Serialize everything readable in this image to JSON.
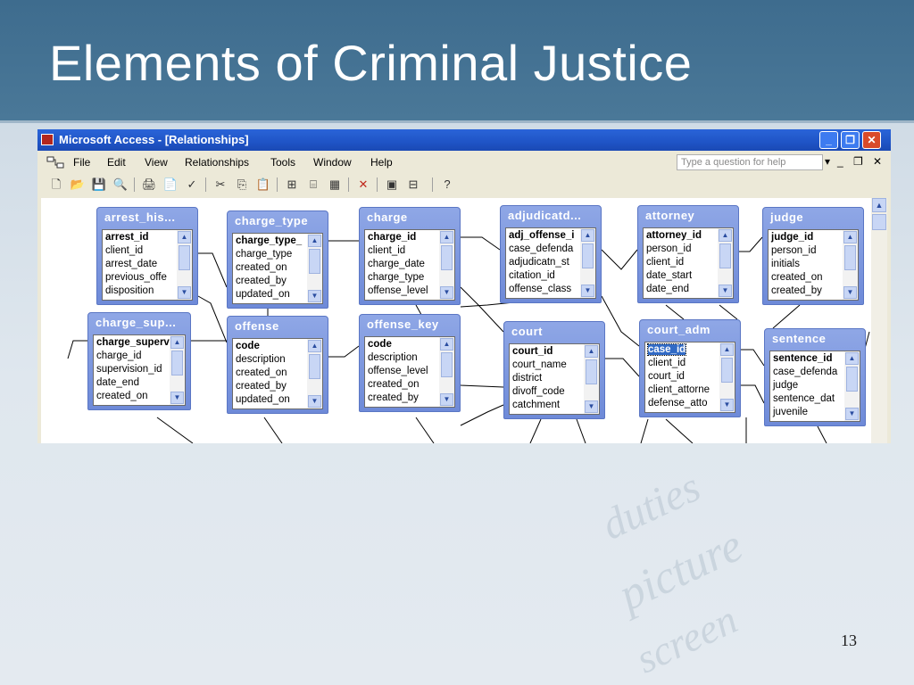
{
  "slide": {
    "title": "Elements of Criminal Justice",
    "page_number": "13",
    "background_words": [
      "duties",
      "picture",
      "screen"
    ]
  },
  "window": {
    "title": "Microsoft Access - [Relationships]",
    "buttons": {
      "minimize": "_",
      "restore": "❐",
      "close": "✕"
    }
  },
  "menu": {
    "items": [
      "File",
      "Edit",
      "View",
      "Relationships",
      "Tools",
      "Window",
      "Help"
    ],
    "ask_placeholder": "Type a question for help",
    "right_controls": [
      "▾",
      "_",
      "❐",
      "✕"
    ]
  },
  "toolbar": {
    "icons": [
      "new-icon",
      "open-icon",
      "save-icon",
      "search-icon",
      "print-icon",
      "print-preview-icon",
      "spelling-icon",
      "cut-icon",
      "copy-icon",
      "paste-icon",
      "show-table-icon",
      "show-direct-icon",
      "show-all-icon",
      "delete-icon",
      "database-window-icon",
      "new-object-icon",
      "help-icon"
    ],
    "glyphs": [
      "🗋",
      "📂",
      "💾",
      "🔍",
      "🖨",
      "📄",
      "✓",
      "✂",
      "⎘",
      "📋",
      "⊞",
      "⌸",
      "▦",
      "✕",
      "▣",
      "⊟",
      "?"
    ]
  },
  "tables": [
    {
      "id": "arrest_history",
      "title": "arrest_his...",
      "fields": [
        {
          "name": "arrest_id",
          "pk": true
        },
        {
          "name": "client_id"
        },
        {
          "name": "arrest_date"
        },
        {
          "name": "previous_offe"
        },
        {
          "name": "disposition"
        }
      ]
    },
    {
      "id": "charge_type",
      "title": "charge_type",
      "fields": [
        {
          "name": "charge_type_",
          "pk": true
        },
        {
          "name": "charge_type"
        },
        {
          "name": "created_on"
        },
        {
          "name": "created_by"
        },
        {
          "name": "updated_on"
        }
      ]
    },
    {
      "id": "charge",
      "title": "charge",
      "fields": [
        {
          "name": "charge_id",
          "pk": true
        },
        {
          "name": "client_id"
        },
        {
          "name": "charge_date"
        },
        {
          "name": "charge_type"
        },
        {
          "name": "offense_level"
        }
      ]
    },
    {
      "id": "adjudicatd",
      "title": "adjudicatd...",
      "fields": [
        {
          "name": "adj_offense_i",
          "pk": true
        },
        {
          "name": "case_defenda"
        },
        {
          "name": "adjudicatn_st"
        },
        {
          "name": "citation_id"
        },
        {
          "name": "offense_class"
        }
      ]
    },
    {
      "id": "attorney",
      "title": "attorney",
      "fields": [
        {
          "name": "attorney_id",
          "pk": true
        },
        {
          "name": "person_id"
        },
        {
          "name": "client_id"
        },
        {
          "name": "date_start"
        },
        {
          "name": "date_end"
        }
      ]
    },
    {
      "id": "judge",
      "title": "judge",
      "fields": [
        {
          "name": "judge_id",
          "pk": true
        },
        {
          "name": "person_id"
        },
        {
          "name": "initials"
        },
        {
          "name": "created_on"
        },
        {
          "name": "created_by"
        }
      ]
    },
    {
      "id": "charge_sup",
      "title": "charge_sup...",
      "fields": [
        {
          "name": "charge_superv",
          "pk": true
        },
        {
          "name": "charge_id"
        },
        {
          "name": "supervision_id"
        },
        {
          "name": "date_end"
        },
        {
          "name": "created_on"
        }
      ]
    },
    {
      "id": "offense",
      "title": "offense",
      "fields": [
        {
          "name": "code",
          "pk": true
        },
        {
          "name": "description"
        },
        {
          "name": "created_on"
        },
        {
          "name": "created_by"
        },
        {
          "name": "updated_on"
        }
      ]
    },
    {
      "id": "offense_key",
      "title": "offense_key",
      "fields": [
        {
          "name": "code",
          "pk": true
        },
        {
          "name": "description"
        },
        {
          "name": "offense_level"
        },
        {
          "name": "created_on"
        },
        {
          "name": "created_by"
        }
      ]
    },
    {
      "id": "court",
      "title": "court",
      "fields": [
        {
          "name": "court_id",
          "pk": true
        },
        {
          "name": "court_name"
        },
        {
          "name": "district"
        },
        {
          "name": "divoff_code"
        },
        {
          "name": "catchment"
        }
      ]
    },
    {
      "id": "court_adm",
      "title": "court_adm",
      "fields": [
        {
          "name": "case_id",
          "pk": true,
          "selected": true
        },
        {
          "name": "client_id"
        },
        {
          "name": "court_id"
        },
        {
          "name": "client_attorne"
        },
        {
          "name": "defense_atto"
        }
      ]
    },
    {
      "id": "sentence",
      "title": "sentence",
      "fields": [
        {
          "name": "sentence_id",
          "pk": true
        },
        {
          "name": "case_defenda"
        },
        {
          "name": "judge"
        },
        {
          "name": "sentence_dat"
        },
        {
          "name": "juvenile"
        }
      ]
    }
  ]
}
